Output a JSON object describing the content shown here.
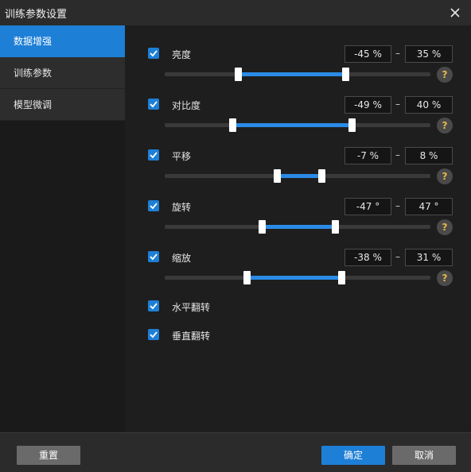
{
  "window": {
    "title": "训练参数设置",
    "close_icon": "close-icon"
  },
  "sidebar": {
    "items": [
      {
        "label": "数据增强",
        "active": true
      },
      {
        "label": "训练参数",
        "active": false
      },
      {
        "label": "模型微调",
        "active": false
      }
    ]
  },
  "params": [
    {
      "label": "亮度",
      "checked": true,
      "min_text": "-45 %",
      "max_text": "35 %",
      "range_min": -45,
      "range_max": 35
    },
    {
      "label": "对比度",
      "checked": true,
      "min_text": "-49 %",
      "max_text": "40 %",
      "range_min": -49,
      "range_max": 40
    },
    {
      "label": "平移",
      "checked": true,
      "min_text": "-7 %",
      "max_text": "8 %",
      "range_min": -7,
      "range_max": 8
    },
    {
      "label": "旋转",
      "checked": true,
      "min_text": "-47 °",
      "max_text": "47 °",
      "range_min": -47,
      "range_max": 47
    },
    {
      "label": "缩放",
      "checked": true,
      "min_text": "-38 %",
      "max_text": "31 %",
      "range_min": -38,
      "range_max": 31
    }
  ],
  "separator": "–",
  "help_label": "?",
  "flips": [
    {
      "label": "水平翻转",
      "checked": true
    },
    {
      "label": "垂直翻转",
      "checked": true
    }
  ],
  "footer": {
    "reset_label": "重置",
    "ok_label": "确定",
    "cancel_label": "取消"
  },
  "colors": {
    "accent": "#1e7fd6",
    "help_glyph": "#e8b84a",
    "background": "#1e1e1e"
  }
}
